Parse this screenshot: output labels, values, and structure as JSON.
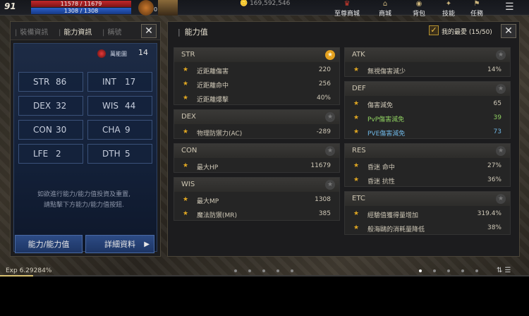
{
  "hud": {
    "level": "91",
    "hp": "11578 / 11679",
    "mp": "1308 / 1308",
    "potion_count": "0",
    "gold": "🪙 169,592,546",
    "menus": [
      {
        "label": "至尊商城",
        "icon": "crown-icon",
        "red": true
      },
      {
        "label": "商城",
        "icon": "shop-icon",
        "red": false
      },
      {
        "label": "背包",
        "icon": "bag-icon",
        "red": false
      },
      {
        "label": "技能",
        "icon": "skill-icon",
        "red": false
      },
      {
        "label": "任務",
        "icon": "quest-icon",
        "red": false
      }
    ],
    "exp": "Exp 6.29284%",
    "exp_percent": 6.29284
  },
  "left_panel": {
    "tabs": [
      "裝備資訊",
      "能力資訊",
      "稱號"
    ],
    "active_tab": 1,
    "remaining_label": "萬能圖",
    "remaining_value": "14",
    "stats": [
      {
        "name": "STR",
        "value": "86"
      },
      {
        "name": "INT",
        "value": "17"
      },
      {
        "name": "DEX",
        "value": "32"
      },
      {
        "name": "WIS",
        "value": "44"
      },
      {
        "name": "CON",
        "value": "30"
      },
      {
        "name": "CHA",
        "value": "9"
      },
      {
        "name": "LFE",
        "value": "2"
      },
      {
        "name": "DTH",
        "value": "5"
      }
    ],
    "hint_line1": "如欲進行能力/能力值投資及重置,",
    "hint_line2": "請點擊下方能力/能力值按鈕.",
    "btn_ability": "能力/能力值",
    "btn_detail": "詳細資料"
  },
  "main_panel": {
    "title": "能力值",
    "favorites_label": "我的最愛 (15/50)",
    "categories": {
      "str": {
        "name": "STR",
        "starred": true,
        "rows": [
          {
            "label": "近距離傷害",
            "value": "220"
          },
          {
            "label": "近距離命中",
            "value": "256"
          },
          {
            "label": "近距離爆擊",
            "value": "40%"
          }
        ]
      },
      "dex": {
        "name": "DEX",
        "starred": false,
        "rows": [
          {
            "label": "物理防禦力(AC)",
            "value": "-289"
          }
        ]
      },
      "con": {
        "name": "CON",
        "starred": false,
        "rows": [
          {
            "label": "最大HP",
            "value": "11679"
          }
        ]
      },
      "wis": {
        "name": "WIS",
        "starred": false,
        "rows": [
          {
            "label": "最大MP",
            "value": "1308"
          },
          {
            "label": "魔法防禦(MR)",
            "value": "385"
          }
        ]
      },
      "atk": {
        "name": "ATK",
        "starred": false,
        "rows": [
          {
            "label": "無視傷害減少",
            "value": "14%"
          }
        ]
      },
      "def": {
        "name": "DEF",
        "starred": false,
        "rows": [
          {
            "label": "傷害減免",
            "value": "65"
          },
          {
            "label": "PvP傷害減免",
            "value": "39"
          },
          {
            "label": "PVE傷害減免",
            "value": "73"
          }
        ]
      },
      "res": {
        "name": "RES",
        "starred": false,
        "rows": [
          {
            "label": "昏迷 命中",
            "value": "27%"
          },
          {
            "label": "昏迷 抗性",
            "value": "36%"
          }
        ]
      },
      "etc": {
        "name": "ETC",
        "starred": false,
        "rows": [
          {
            "label": "經驗值獲得量增加",
            "value": "319.4%"
          },
          {
            "label": "般海鷗的消耗量降低",
            "value": "38%"
          }
        ]
      }
    }
  },
  "colors": {
    "accent_gold": "#e4a11f",
    "pvp_green": "#8fd061",
    "pve_blue": "#6fb7e5",
    "button_blue": "#2d4b85"
  }
}
